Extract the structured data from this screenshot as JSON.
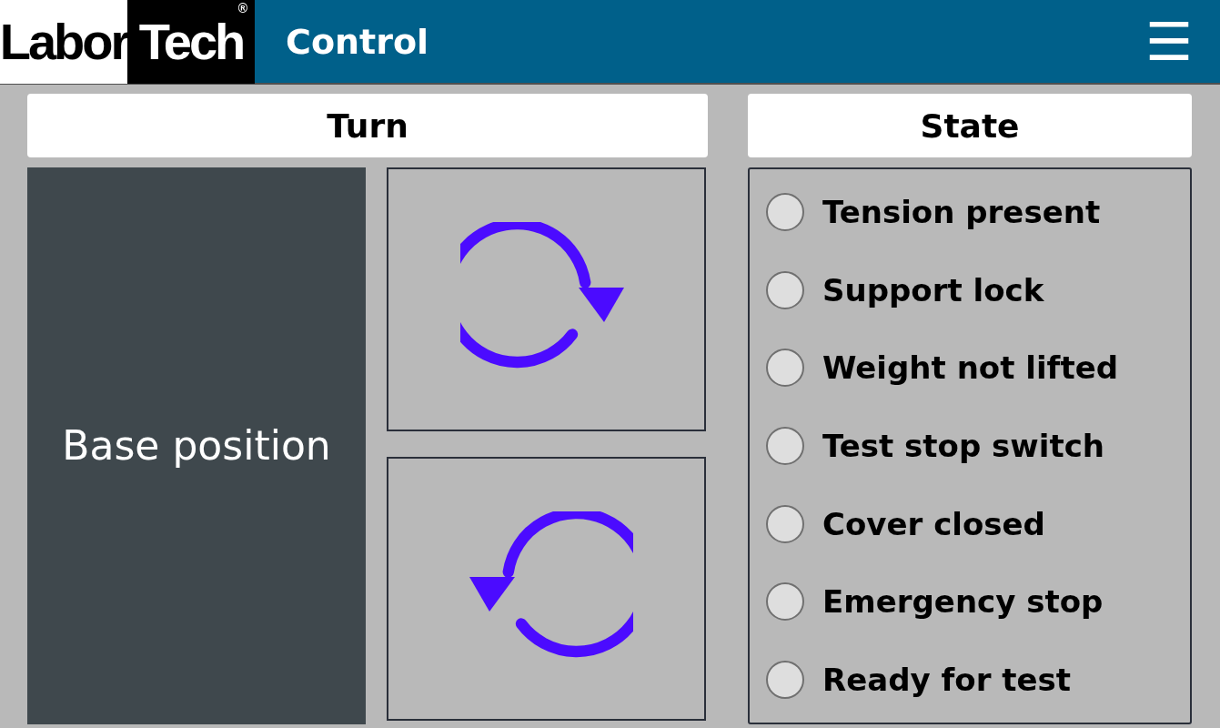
{
  "logo": {
    "left": "Labor",
    "right": "Tech",
    "mark": "®"
  },
  "header": {
    "title": "Control",
    "menu_icon": "☰"
  },
  "turn": {
    "title": "Turn",
    "base_button": "Base position",
    "rotate_buttons": [
      {
        "kind": "clockwise"
      },
      {
        "kind": "counterclockwise"
      }
    ]
  },
  "state": {
    "title": "State",
    "indicators": [
      {
        "label": "Tension present",
        "on": false
      },
      {
        "label": "Support lock",
        "on": false
      },
      {
        "label": "Weight not lifted",
        "on": false
      },
      {
        "label": "Test stop switch",
        "on": false
      },
      {
        "label": "Cover closed",
        "on": false
      },
      {
        "label": "Emergency stop",
        "on": false
      },
      {
        "label": "Ready for test",
        "on": false
      }
    ]
  }
}
